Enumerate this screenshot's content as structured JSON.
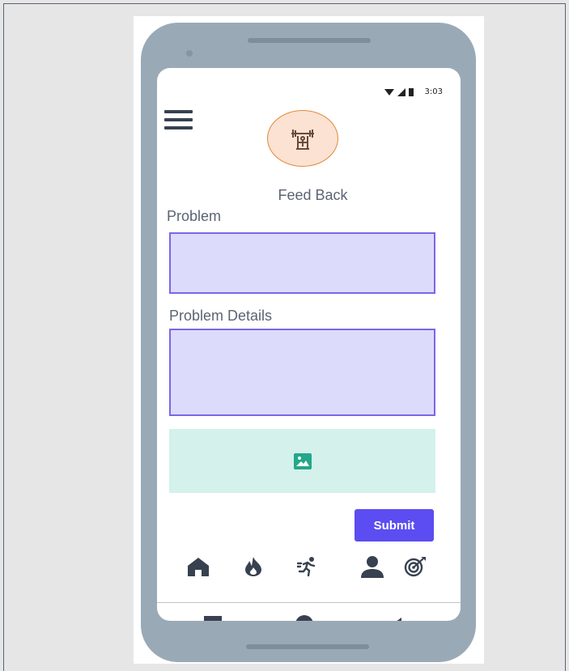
{
  "status_bar": {
    "time": "3:03"
  },
  "header": {
    "title": "Feed Back"
  },
  "form": {
    "problem_label": "Problem",
    "problem_value": "",
    "details_label": "Problem Details",
    "details_value": "",
    "submit_label": "Submit"
  },
  "bottom_nav": {
    "items": [
      {
        "icon": "home-icon"
      },
      {
        "icon": "fire-icon"
      },
      {
        "icon": "running-icon"
      },
      {
        "icon": "user-icon"
      },
      {
        "icon": "target-icon"
      }
    ]
  },
  "system_nav": {
    "items": [
      "recent-apps-icon",
      "home-circle-icon",
      "back-icon"
    ]
  },
  "colors": {
    "accent": "#5b4df1",
    "field_fill": "#dcdbfb",
    "field_border": "#7967e6",
    "upload_fill": "#d4f1ec",
    "upload_icon": "#23a889",
    "logo_fill": "#fbe2d2",
    "logo_border": "#e08a3c",
    "phone_body": "#9aa9b6",
    "nav_icon": "#384150"
  }
}
